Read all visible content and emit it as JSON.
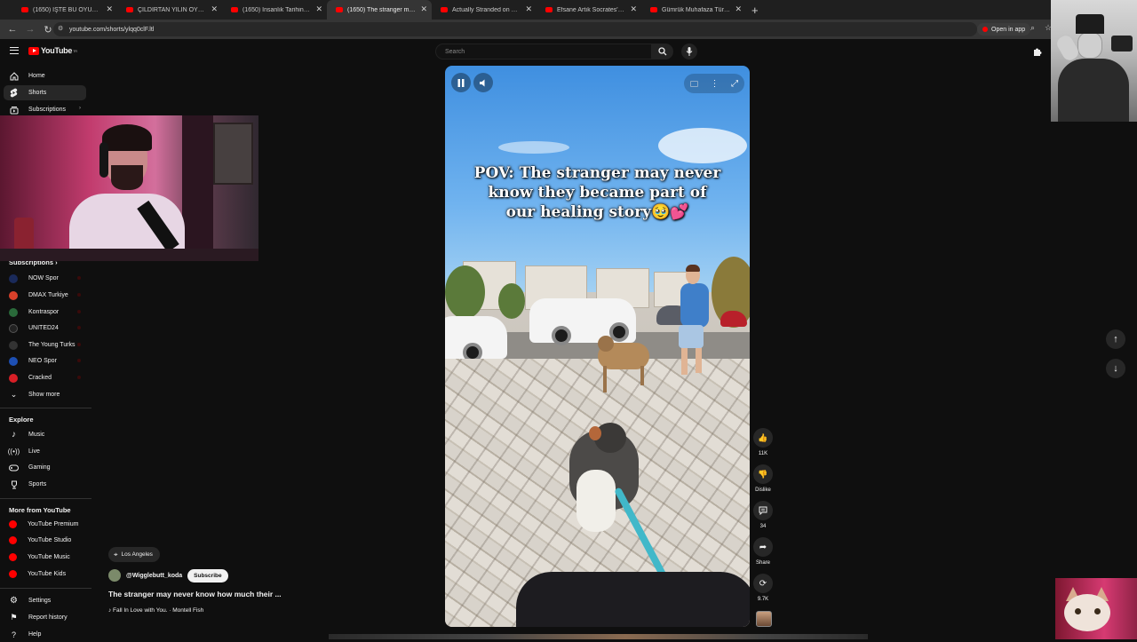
{
  "browser": {
    "tabs": [
      {
        "title": "(1650) İŞTE BU OYUN OYNANIR",
        "active": false
      },
      {
        "title": "ÇILDIRTAN YILIN OYUNU ADAY",
        "active": false
      },
      {
        "title": "(1650) İnsanlık Tarihinin En Tehli",
        "active": false
      },
      {
        "title": "(1650) The stranger may n",
        "active": true
      },
      {
        "title": "Actually Stranded on a Desert Is",
        "active": false
      },
      {
        "title": "Efsane Artık Socrates'te, Ada F",
        "active": false
      },
      {
        "title": "Gümrük Muhafaza Türkiye 24. S",
        "active": false
      }
    ],
    "new_tab_label": "+",
    "url": "youtube.com/shorts/ylqq0clF.ltl",
    "open_in_app": "Open in app"
  },
  "header": {
    "logo_text": "YouTube",
    "logo_region": "TR",
    "search_placeholder": "Search"
  },
  "sidebar": {
    "main": [
      {
        "label": "Home",
        "icon": "home-icon"
      },
      {
        "label": "Shorts",
        "icon": "shorts-icon",
        "active": true
      },
      {
        "label": "Subscriptions",
        "icon": "subscriptions-icon"
      }
    ],
    "subscriptions_heading": "Subscriptions",
    "subscriptions": [
      {
        "label": "NOW Spor",
        "color": "#1a2a5a"
      },
      {
        "label": "DMAX Turkiye",
        "color": "#d9412b"
      },
      {
        "label": "Kontraspor",
        "color": "#2a6a3a"
      },
      {
        "label": "UNITED24",
        "color": "#222222"
      },
      {
        "label": "The Young Turks",
        "color": "#333333"
      },
      {
        "label": "NEO Spor",
        "color": "#1d4fb3"
      },
      {
        "label": "Cracked",
        "color": "#d81f26"
      }
    ],
    "show_more": "Show more",
    "explore_heading": "Explore",
    "explore": [
      {
        "label": "Music",
        "icon": "music-note-icon"
      },
      {
        "label": "Live",
        "icon": "live-icon"
      },
      {
        "label": "Gaming",
        "icon": "gaming-icon"
      },
      {
        "label": "Sports",
        "icon": "trophy-icon"
      }
    ],
    "more_heading": "More from YouTube",
    "more": [
      {
        "label": "YouTube Premium"
      },
      {
        "label": "YouTube Studio"
      },
      {
        "label": "YouTube Music"
      },
      {
        "label": "YouTube Kids"
      }
    ],
    "footer": [
      {
        "label": "Settings",
        "icon": "gear-icon"
      },
      {
        "label": "Report history",
        "icon": "flag-icon"
      },
      {
        "label": "Help",
        "icon": "help-icon"
      }
    ]
  },
  "short": {
    "caption_line1": "POV: The stranger may never",
    "caption_line2": "know they became part of",
    "caption_line3": "our healing story🥹💕",
    "location": "Los Angeles",
    "channel": "@Wigglebutt_koda",
    "subscribe_label": "Subscribe",
    "title": "The stranger may never know how much their ...",
    "song": "♪ Fall In Love with You. · Montell Fish"
  },
  "actions": {
    "like_count": "11K",
    "dislike_label": "Dislike",
    "comments_count": "34",
    "share_label": "Share",
    "remix_count": "9.7K"
  },
  "colors": {
    "background": "#0f0f0f",
    "brand_red": "#ff0000",
    "chip": "#272727"
  }
}
